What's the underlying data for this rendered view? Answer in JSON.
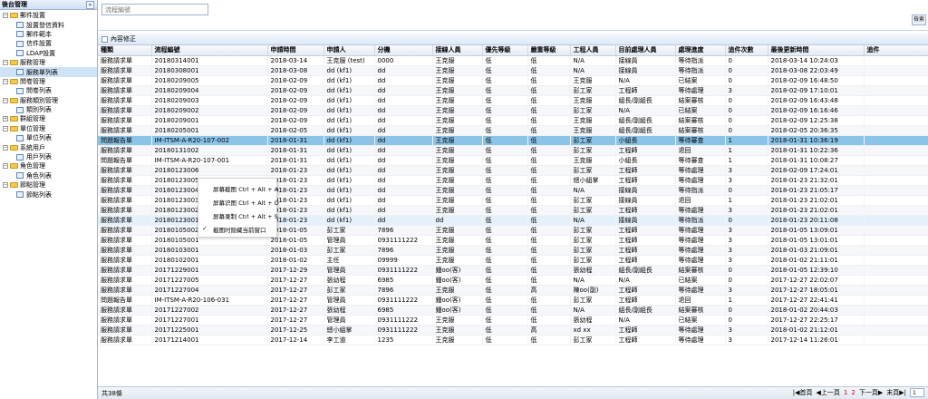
{
  "sidebar": {
    "title": "後台管理",
    "collapse_icon": "double-chevron-left-icon",
    "tree": [
      {
        "label": "郵件設置",
        "children": [
          "設置發信資料",
          "郵件範本",
          "信件設置",
          "LDAP設置"
        ]
      },
      {
        "label": "服務管理",
        "children": [
          "服務單列表"
        ],
        "selected_child": 0
      },
      {
        "label": "問卷管理",
        "children": [
          "問卷列表"
        ]
      },
      {
        "label": "服務類別管理",
        "children": [
          "類別列表"
        ]
      },
      {
        "label": "群組管理",
        "children": []
      },
      {
        "label": "單位管理",
        "children": [
          "單位列表"
        ]
      },
      {
        "label": "系統用戶",
        "children": [
          "用戶列表"
        ]
      },
      {
        "label": "角色管理",
        "children": [
          "角色列表"
        ]
      },
      {
        "label": "節點管理",
        "children": [
          "節點列表"
        ]
      }
    ]
  },
  "topbar": {
    "search_placeholder": "流程編號",
    "query_button": "檢索"
  },
  "panel_title": "內容修正",
  "columns": [
    "種類",
    "流程編號",
    "申請時間",
    "申請人",
    "分機",
    "接線人員",
    "優先等級",
    "嚴重等級",
    "工程人員",
    "目前處理人員",
    "處理進度",
    "追件次數",
    "最後更新時間",
    "追件"
  ],
  "rows": [
    [
      "服務請求單",
      "20180314001",
      "2018-03-14",
      "王克服 (test)",
      "0000",
      "王克服",
      "低",
      "低",
      "N/A",
      "接線員",
      "等待指派",
      "0",
      "2018-03-14 10:24:03",
      ""
    ],
    [
      "服務請求單",
      "20180308001",
      "2018-03-08",
      "dd (kf1)",
      "dd",
      "王克服",
      "低",
      "低",
      "N/A",
      "接線員",
      "等待指派",
      "0",
      "2018-03-08 22:03:49",
      ""
    ],
    [
      "服務請求單",
      "20180209005",
      "2018-02-09",
      "dd (kf1)",
      "dd",
      "王克服",
      "低",
      "低",
      "王克服",
      "N/A",
      "已結案",
      "0",
      "2018-02-09 16:48:50",
      ""
    ],
    [
      "服務請求單",
      "20180209004",
      "2018-02-09",
      "dd (kf1)",
      "dd",
      "王克服",
      "低",
      "低",
      "彭工家",
      "工程師",
      "等待處理",
      "3",
      "2018-02-09 17:10:01",
      ""
    ],
    [
      "服務請求單",
      "20180209003",
      "2018-02-09",
      "dd (kf1)",
      "dd",
      "王克服",
      "低",
      "低",
      "王克服",
      "組長/副組長",
      "結案審核",
      "0",
      "2018-02-09 16:43:48",
      ""
    ],
    [
      "服務請求單",
      "20180209002",
      "2018-02-09",
      "dd (kf1)",
      "dd",
      "王克服",
      "低",
      "低",
      "彭工家",
      "N/A",
      "已結案",
      "0",
      "2018-02-09 16:16:46",
      ""
    ],
    [
      "服務請求單",
      "20180209001",
      "2018-02-09",
      "dd (kf1)",
      "dd",
      "王克服",
      "低",
      "低",
      "王克服",
      "組長/副組長",
      "結案審核",
      "0",
      "2018-02-09 12:25:38",
      ""
    ],
    [
      "服務請求單",
      "20180205001",
      "2018-02-05",
      "dd (kf1)",
      "dd",
      "王克服",
      "低",
      "低",
      "王克服",
      "組長/副組長",
      "結案審核",
      "0",
      "2018-02-05 20:36:35",
      ""
    ],
    [
      "問題報告單",
      "IM-ITSM-A-R20-107-002",
      "2018-01-31",
      "dd (kf1)",
      "dd",
      "王克服",
      "低",
      "低",
      "彭工家",
      "小組長",
      "等待審查",
      "1",
      "2018-01-31 10:36:19",
      ""
    ],
    [
      "服務請求單",
      "20180131002",
      "2018-01-31",
      "dd (kf1)",
      "dd",
      "王克服",
      "低",
      "低",
      "彭工家",
      "工程師",
      "退回",
      "1",
      "2018-01-31 10:22:36",
      ""
    ],
    [
      "問題報告單",
      "IM-ITSM-A-R20-107-001",
      "2018-01-31",
      "dd (kf1)",
      "dd",
      "王克服",
      "低",
      "低",
      "王克服",
      "小組長",
      "等待審查",
      "1",
      "2018-01-31 10:08:27",
      ""
    ],
    [
      "服務請求單",
      "20180123006",
      "2018-01-23",
      "dd (kf1)",
      "dd",
      "王克服",
      "低",
      "低",
      "彭工家",
      "工程師",
      "等待處理",
      "3",
      "2018-02-09 17:24:01",
      ""
    ],
    [
      "服務請求單",
      "20180123005",
      "2018-01-23",
      "dd (kf1)",
      "dd",
      "王克服",
      "低",
      "低",
      "總小組掌",
      "工程師",
      "等待處理",
      "3",
      "2018-01-23 21:32:01",
      ""
    ],
    [
      "服務請求單",
      "20180123004",
      "2018-01-23",
      "dd (kf1)",
      "dd",
      "王克服",
      "低",
      "低",
      "N/A",
      "接線員",
      "等待指派",
      "0",
      "2018-01-23 21:05:17",
      ""
    ],
    [
      "服務請求單",
      "20180123003",
      "2018-01-23",
      "dd (kf1)",
      "dd",
      "王克服",
      "低",
      "低",
      "彭工家",
      "接線員",
      "退回",
      "1",
      "2018-01-23 21:02:01",
      ""
    ],
    [
      "服務請求單",
      "20180123002",
      "2018-01-23",
      "dd (kf1)",
      "dd",
      "王克服",
      "低",
      "低",
      "彭工家",
      "工程師",
      "等待處理",
      "3",
      "2018-01-23 21:02:01",
      ""
    ],
    [
      "服務請求單",
      "20180123001",
      "2018-01-23",
      "dd (kf1)",
      "dd",
      "dd",
      "低",
      "低",
      "N/A",
      "接線員",
      "等待指派",
      "0",
      "2018-01-23 20:11:08",
      ""
    ],
    [
      "服務請求單",
      "20180105002",
      "2018-01-05",
      "彭工家",
      "7896",
      "王克服",
      "低",
      "低",
      "彭工家",
      "工程師",
      "等待處理",
      "3",
      "2018-01-05 13:09:01",
      ""
    ],
    [
      "服務請求單",
      "20180105001",
      "2018-01-05",
      "管理員",
      "0931111222",
      "王克服",
      "低",
      "低",
      "彭工家",
      "工程師",
      "等待處理",
      "3",
      "2018-01-05 13:01:01",
      ""
    ],
    [
      "服務請求單",
      "20180103001",
      "2018-01-03",
      "彭工家",
      "7896",
      "王克服",
      "低",
      "低",
      "彭工家",
      "工程師",
      "等待處理",
      "3",
      "2018-01-03 21:09:01",
      ""
    ],
    [
      "服務請求單",
      "20180102001",
      "2018-01-02",
      "主任",
      "09999",
      "王克服",
      "低",
      "低",
      "彭工家",
      "工程師",
      "等待處理",
      "3",
      "2018-01-02 21:11:01",
      ""
    ],
    [
      "服務請求單",
      "20171229001",
      "2017-12-29",
      "管理員",
      "0931111222",
      "鍾oo(客)",
      "低",
      "低",
      "張幼程",
      "組長/副組長",
      "結案審核",
      "0",
      "2018-01-05 12:39:10",
      ""
    ],
    [
      "服務請求單",
      "20171227005",
      "2017-12-27",
      "張幼程",
      "6985",
      "鍾oo(客)",
      "低",
      "低",
      "N/A",
      "N/A",
      "已結案",
      "0",
      "2017-12-27 22:02:07",
      ""
    ],
    [
      "服務請求單",
      "20171227004",
      "2017-12-27",
      "彭工家",
      "7896",
      "王克服",
      "低",
      "高",
      "陳oo(副)",
      "工程師",
      "等待處理",
      "3",
      "2017-12-27 18:05:01",
      ""
    ],
    [
      "問題報告單",
      "IM-ITSM-A-R20-106-031",
      "2017-12-27",
      "管理員",
      "0931111222",
      "鍾oo(客)",
      "低",
      "低",
      "彭工家",
      "工程師",
      "退回",
      "1",
      "2017-12-27 22:41:41",
      ""
    ],
    [
      "服務請求單",
      "20171227002",
      "2017-12-27",
      "張幼程",
      "6985",
      "鍾oo(客)",
      "低",
      "低",
      "N/A",
      "組長/副組長",
      "結案審核",
      "0",
      "2018-01-02 20:44:03",
      ""
    ],
    [
      "服務請求單",
      "20171227001",
      "2017-12-27",
      "管理員",
      "0931111222",
      "王克服",
      "低",
      "低",
      "張幼程",
      "N/A",
      "已結案",
      "0",
      "2017-12-27 22:25:17",
      ""
    ],
    [
      "服務請求單",
      "20171225001",
      "2017-12-25",
      "總小組掌",
      "0931111222",
      "王克服",
      "低",
      "高",
      "xd xx",
      "工程師",
      "等待處理",
      "3",
      "2018-01-02 21:12:01",
      ""
    ],
    [
      "服務請求單",
      "20171214001",
      "2017-12-14",
      "李工道",
      "1235",
      "王克服",
      "低",
      "低",
      "彭工家",
      "工程師",
      "等待處理",
      "3",
      "2017-12-14 11:26:01",
      ""
    ]
  ],
  "footer": {
    "total": "共38條",
    "first": "|◀首頁",
    "prev": "◀上一頁",
    "page1": "1",
    "page2": "2",
    "next": "下一頁▶",
    "last": "末頁▶|",
    "page_input": "1"
  },
  "context_menu": [
    {
      "label": "屏幕截图 Ctrl + Alt + A",
      "checked": false
    },
    {
      "label": "屏幕识图 Ctrl + Alt + O",
      "checked": false
    },
    {
      "label": "屏幕录制 Ctrl + Alt + S",
      "checked": false
    },
    {
      "label": "截图时隐藏当前窗口",
      "checked": true
    }
  ]
}
